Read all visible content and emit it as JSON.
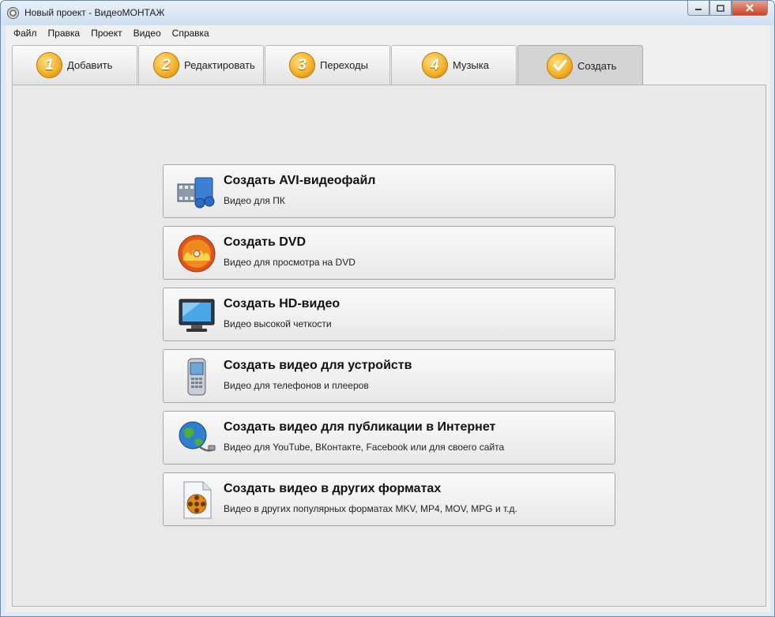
{
  "window": {
    "title": "Новый проект - ВидеоМОНТАЖ"
  },
  "menu": [
    "Файл",
    "Правка",
    "Проект",
    "Видео",
    "Справка"
  ],
  "tabs": [
    {
      "num": "1",
      "label": "Добавить",
      "active": false
    },
    {
      "num": "2",
      "label": "Редактировать",
      "active": false
    },
    {
      "num": "3",
      "label": "Переходы",
      "active": false
    },
    {
      "num": "4",
      "label": "Музыка",
      "active": false
    },
    {
      "num": "check",
      "label": "Создать",
      "active": true
    }
  ],
  "actions": [
    {
      "title": "Создать AVI-видеофайл",
      "sub": "Видео для ПК",
      "icon": "film-strip-icon"
    },
    {
      "title": "Создать DVD",
      "sub": "Видео для просмотра на DVD",
      "icon": "dvd-disc-icon"
    },
    {
      "title": "Создать HD-видео",
      "sub": "Видео высокой четкости",
      "icon": "monitor-icon"
    },
    {
      "title": "Создать видео для устройств",
      "sub": "Видео для телефонов и плееров",
      "icon": "phone-icon"
    },
    {
      "title": "Создать видео для публикации в Интернет",
      "sub": "Видео для YouTube, ВКонтакте, Facebook или для своего сайта",
      "icon": "globe-icon"
    },
    {
      "title": "Создать видео в других форматах",
      "sub": "Видео в других популярных форматах MKV, MP4, MOV, MPG и т.д.",
      "icon": "video-file-icon"
    }
  ],
  "colors": {
    "accent_orange": "#f5b22a",
    "active_tab": "#d4d4d4",
    "panel": "#e9e9e9"
  }
}
